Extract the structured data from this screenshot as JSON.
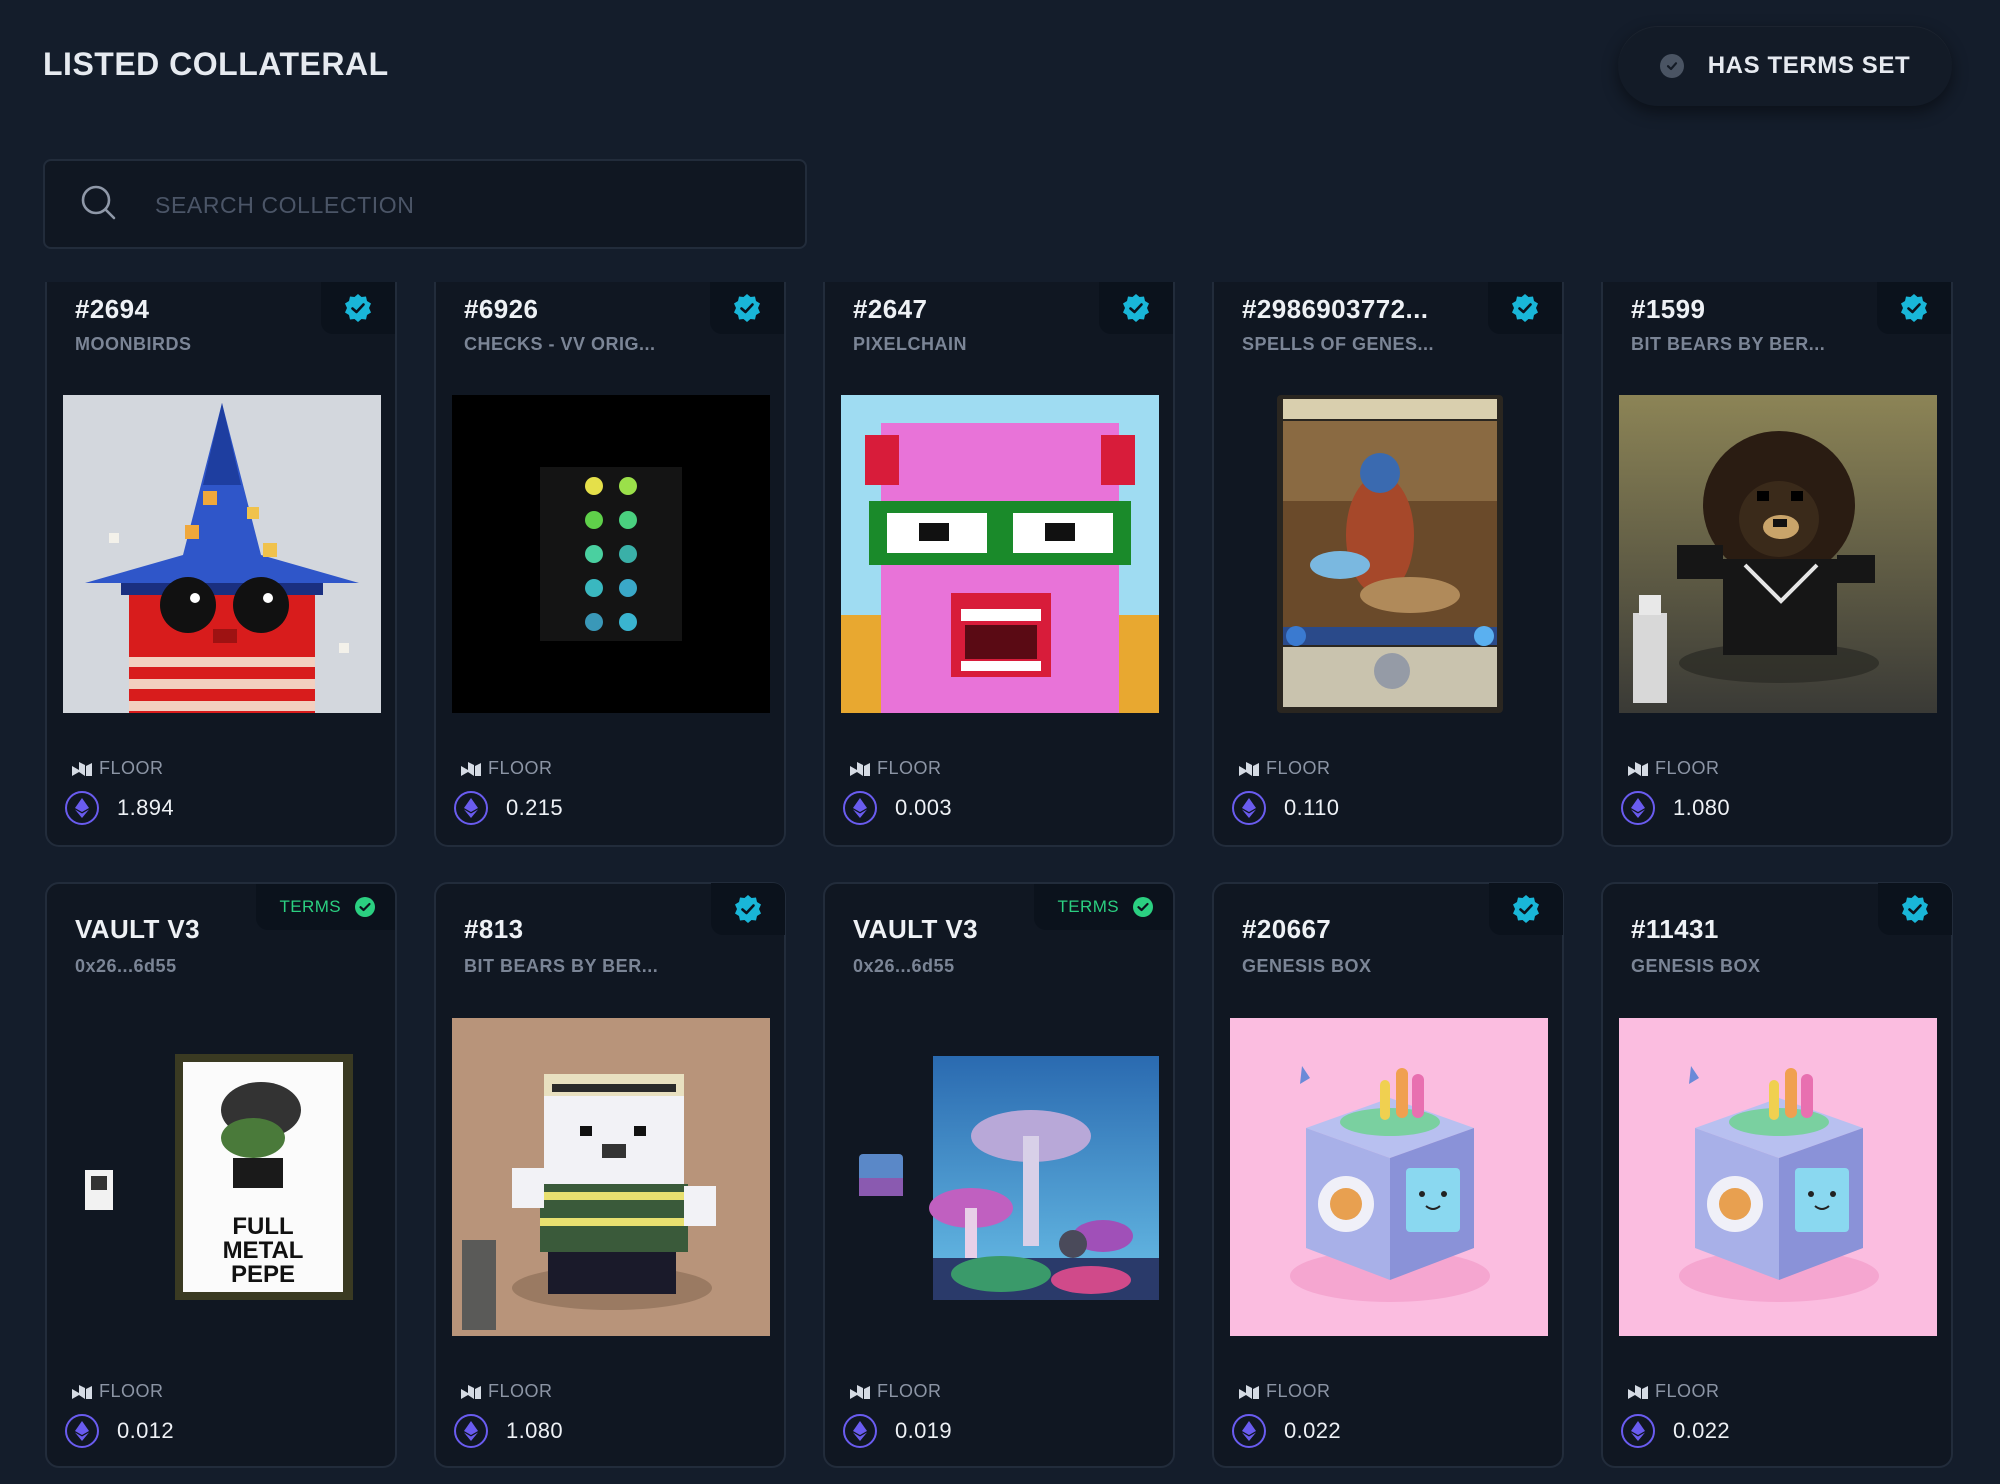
{
  "header": {
    "title": "LISTED COLLATERAL",
    "filter_label": "HAS TERMS SET"
  },
  "search": {
    "placeholder": "SEARCH COLLECTION"
  },
  "colors": {
    "background": "#141d2b",
    "card": "#101722",
    "verified": "#19b6d8",
    "terms": "#2bd081",
    "eth": "#6a5cf0"
  },
  "cards": [
    {
      "title": "#2694",
      "subtitle": "MOONBIRDS",
      "floor_label": "FLOOR",
      "price": "1.894",
      "badge": "verified-icon",
      "image": "moonbird-wizard-art"
    },
    {
      "title": "#6926",
      "subtitle": "CHECKS - VV ORIG...",
      "floor_label": "FLOOR",
      "price": "0.215",
      "badge": "verified-icon",
      "image": "checks-grid-art"
    },
    {
      "title": "#2647",
      "subtitle": "PIXELCHAIN",
      "floor_label": "FLOOR",
      "price": "0.003",
      "badge": "verified-icon",
      "image": "pink-pixel-monster-art"
    },
    {
      "title": "#2986903772...",
      "subtitle": "SPELLS OF GENES...",
      "floor_label": "FLOOR",
      "price": "0.110",
      "badge": "verified-icon",
      "image": "spell-card-art"
    },
    {
      "title": "#1599",
      "subtitle": "BIT BEARS BY BER...",
      "floor_label": "FLOOR",
      "price": "1.080",
      "badge": "verified-icon",
      "image": "pixel-black-bear-art"
    },
    {
      "title": "VAULT V3",
      "subtitle": "0x26...6d55",
      "floor_label": "FLOOR",
      "price": "0.012",
      "badge": "terms",
      "terms_label": "TERMS",
      "image": "full-metal-pepe-art",
      "poster_text": "FULL METAL PEPE"
    },
    {
      "title": "#813",
      "subtitle": "BIT BEARS BY BER...",
      "floor_label": "FLOOR",
      "price": "1.080",
      "badge": "verified-icon",
      "image": "pixel-polar-bear-art"
    },
    {
      "title": "VAULT V3",
      "subtitle": "0x26...6d55",
      "floor_label": "FLOOR",
      "price": "0.019",
      "badge": "terms",
      "terms_label": "TERMS",
      "image": "mushroom-landscape-art"
    },
    {
      "title": "#20667",
      "subtitle": "GENESIS BOX",
      "floor_label": "FLOOR",
      "price": "0.022",
      "badge": "verified-icon",
      "image": "genesis-box-art"
    },
    {
      "title": "#11431",
      "subtitle": "GENESIS BOX",
      "floor_label": "FLOOR",
      "price": "0.022",
      "badge": "verified-icon",
      "image": "genesis-box-art"
    }
  ]
}
